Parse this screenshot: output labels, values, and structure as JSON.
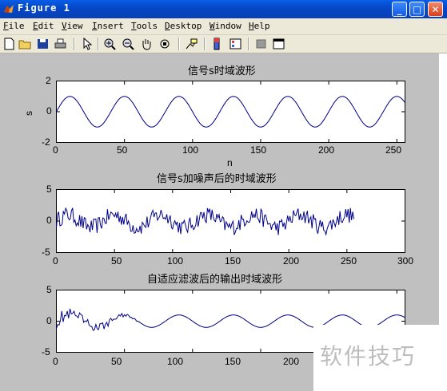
{
  "window": {
    "title": "Figure 1",
    "min": "_",
    "max": "□",
    "close": "✕"
  },
  "menu": [
    "File",
    "Edit",
    "View",
    "Insert",
    "Tools",
    "Desktop",
    "Window",
    "Help"
  ],
  "toolbar_icons": [
    "new-file-icon",
    "open-folder-icon",
    "save-icon",
    "print-icon",
    "pointer-icon",
    "zoom-in-icon",
    "zoom-out-icon",
    "pan-hand-icon",
    "rotate-3d-icon",
    "data-cursor-icon",
    "colorbar-icon",
    "legend-icon",
    "hide-plot-tools-icon",
    "show-plot-tools-icon"
  ],
  "plots": [
    {
      "title": "信号s时域波形",
      "ylabel": "s",
      "xlabel": "n",
      "xticks": [
        "0",
        "50",
        "100",
        "150",
        "200",
        "250"
      ],
      "yticks": [
        "2",
        "0",
        "-2"
      ]
    },
    {
      "title": "信号s加噪声后的时域波形",
      "xticks": [
        "0",
        "50",
        "100",
        "150",
        "200",
        "250",
        "300"
      ],
      "yticks": [
        "5",
        "0",
        "-5"
      ]
    },
    {
      "title": "自适应滤波后的输出时域波形",
      "xticks": [
        "0",
        "50",
        "100",
        "150",
        "200"
      ],
      "yticks": [
        "5",
        "0",
        "-5"
      ]
    }
  ],
  "watermark": "软件技巧",
  "chart_data": [
    {
      "type": "line",
      "title": "信号s时域波形",
      "xlabel": "n",
      "ylabel": "s",
      "xlim": [
        0,
        256
      ],
      "ylim": [
        -2,
        2
      ],
      "series": [
        {
          "formula": "sin(2*pi*n/40)",
          "x": [
            0,
            10,
            20,
            30,
            40,
            50,
            60,
            70,
            80,
            90,
            100,
            110,
            120,
            130,
            140,
            150,
            160,
            170,
            180,
            190,
            200,
            210,
            220,
            230,
            240,
            250,
            256
          ],
          "values": [
            0,
            1,
            0,
            -1,
            0,
            1,
            0,
            -1,
            0,
            1,
            0,
            -1,
            0,
            1,
            0,
            -1,
            0,
            1,
            0,
            -1,
            0,
            1,
            0,
            -1,
            0,
            1,
            0.77
          ]
        }
      ]
    },
    {
      "type": "line",
      "title": "信号s加噪声后的时域波形",
      "xlim": [
        0,
        300
      ],
      "ylim": [
        -5,
        5
      ],
      "series": [
        {
          "x": [
            0,
            10,
            20,
            30,
            40,
            50,
            60,
            70,
            80,
            90,
            100,
            110,
            120,
            130,
            140,
            150,
            160,
            170,
            180,
            190,
            200,
            210,
            220,
            230,
            240,
            250,
            256
          ],
          "values": [
            0,
            1.2,
            -0.3,
            -0.8,
            0.4,
            1.1,
            0.2,
            -1.0,
            0,
            1.2,
            0,
            -0.9,
            0.3,
            1.3,
            0,
            -1.1,
            0.2,
            1.2,
            0.1,
            -0.9,
            0,
            1.0,
            0,
            -1.3,
            0,
            0.8,
            1.0
          ]
        }
      ]
    },
    {
      "type": "line",
      "title": "自适应滤波后的输出时域波形",
      "xlim": [
        0,
        256
      ],
      "ylim": [
        -5,
        5
      ],
      "series": [
        {
          "x": [
            0,
            10,
            20,
            30,
            40,
            50,
            60,
            70,
            80,
            90,
            100,
            110,
            120,
            130,
            140,
            150,
            160,
            170,
            180,
            190,
            200,
            210,
            220,
            230,
            240,
            250
          ],
          "values": [
            0,
            1.3,
            -0.5,
            -0.6,
            0.3,
            0.9,
            0.1,
            -0.9,
            0,
            0.9,
            0,
            -0.9,
            0,
            0.9,
            0,
            -0.9,
            0,
            0.9,
            0,
            -0.9,
            0,
            0.9,
            0,
            -0.9,
            0,
            0.9
          ]
        }
      ]
    }
  ]
}
